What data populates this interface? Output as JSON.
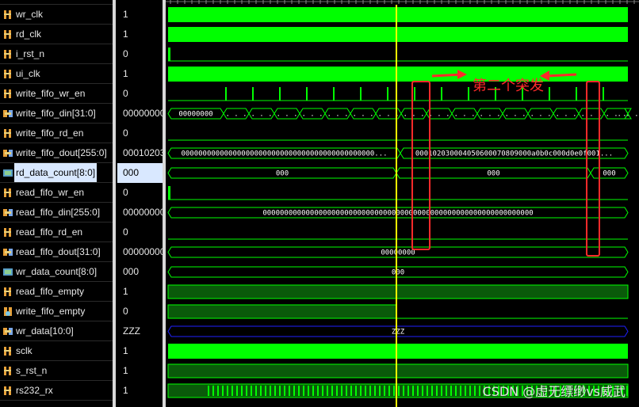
{
  "signals": [
    {
      "name": "wr_clk",
      "value": "1",
      "icon": "bit-signal-icon",
      "wave": "clk"
    },
    {
      "name": "rd_clk",
      "value": "1",
      "icon": "bit-signal-icon",
      "wave": "clk"
    },
    {
      "name": "i_rst_n",
      "value": "0",
      "icon": "bit-signal-icon",
      "wave": "low_pulse"
    },
    {
      "name": "ui_clk",
      "value": "1",
      "icon": "bit-signal-icon",
      "wave": "clk"
    },
    {
      "name": "write_fifo_wr_en",
      "value": "0",
      "icon": "bit-signal-icon",
      "wave": "pulses"
    },
    {
      "name": "write_fifo_din[31:0]",
      "value": "00000000",
      "icon": "bus-signal-icon",
      "wave": "bus_many"
    },
    {
      "name": "write_fifo_rd_en",
      "value": "0",
      "icon": "bit-signal-icon",
      "wave": "low"
    },
    {
      "name": "write_fifo_dout[255:0]",
      "value": "00010203",
      "icon": "bus-signal-icon",
      "wave": "bus_dout"
    },
    {
      "name": "rd_data_count[8:0]",
      "value": "000",
      "icon": "count-signal-icon",
      "wave": "bus_count",
      "selected": true
    },
    {
      "name": "read_fifo_wr_en",
      "value": "0",
      "icon": "bit-signal-icon",
      "wave": "low_pulse"
    },
    {
      "name": "read_fifo_din[255:0]",
      "value": "00000000",
      "icon": "bus-signal-icon",
      "wave": "bus_single"
    },
    {
      "name": "read_fifo_rd_en",
      "value": "0",
      "icon": "bit-signal-icon",
      "wave": "low"
    },
    {
      "name": "read_fifo_dout[31:0]",
      "value": "00000000",
      "icon": "bus-signal-icon",
      "wave": "bus_single"
    },
    {
      "name": "wr_data_count[8:0]",
      "value": "000",
      "icon": "count-signal-icon",
      "wave": "bus_single"
    },
    {
      "name": "read_fifo_empty",
      "value": "1",
      "icon": "bit-signal-icon",
      "wave": "high"
    },
    {
      "name": "write_fifo_empty",
      "value": "0",
      "icon": "empty-signal-icon",
      "wave": "high_then_low"
    },
    {
      "name": "wr_data[10:0]",
      "value": "ZZZ",
      "icon": "bus-signal-icon",
      "wave": "bus_z"
    },
    {
      "name": "sclk",
      "value": "1",
      "icon": "bit-signal-icon",
      "wave": "clk"
    },
    {
      "name": "s_rst_n",
      "value": "1",
      "icon": "bit-signal-icon",
      "wave": "high"
    },
    {
      "name": "rs232_rx",
      "value": "1",
      "icon": "bit-signal-icon",
      "wave": "rx"
    }
  ],
  "bus_labels": {
    "write_fifo_din": [
      "00000000",
      ". . .",
      ". . .",
      ". . .",
      ". . .",
      ". . .",
      ". . .",
      ". . .",
      ". . .",
      ". . .",
      ". . .",
      ". . .",
      ". . .",
      ". . .",
      ". . .",
      ". . .",
      ". . .",
      ". . ."
    ],
    "write_fifo_dout_a": "000000000000000000000000000000000000000000000...",
    "write_fifo_dout_b": "000102030004050600070809000a0b0c000d0e0f001...",
    "rd_data_count_a": "000",
    "rd_data_count_b": "000",
    "rd_data_count_c": "000",
    "read_fifo_din": "000000000000000000000000000000000000000000000000000000000000000",
    "read_fifo_dout": "00000000",
    "wr_data_count": "000",
    "wr_data": "ZZZ"
  },
  "annotation": {
    "text": "第二个突发",
    "color": "#ff2a2a"
  },
  "watermark": "CSDN @虚无缥缈vs威武",
  "colors": {
    "wave": "#00ff00",
    "wave_dim": "#0a5a0a",
    "cursor": "#ffff00",
    "bus_z": "#2020ff",
    "annotation": "#ff2a2a"
  }
}
